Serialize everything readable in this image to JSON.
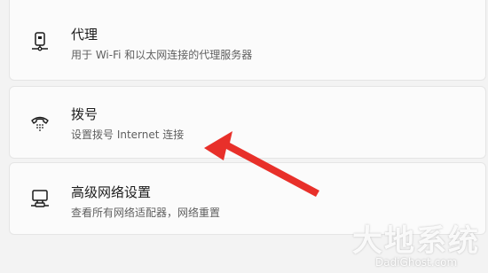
{
  "items": [
    {
      "title": "代理",
      "description": "用于 Wi-Fi 和以太网连接的代理服务器",
      "icon": "proxy-server-icon"
    },
    {
      "title": "拨号",
      "description": "设置拨号 Internet 连接",
      "icon": "dial-up-phone-icon"
    },
    {
      "title": "高级网络设置",
      "description": "查看所有网络适配器，网络重置",
      "icon": "network-pc-icon"
    }
  ],
  "watermark": {
    "logo_text": "大地系统",
    "url": "DadiGhost.com"
  },
  "colors": {
    "arrow": "#e8302a",
    "card": "#fbfbfb",
    "background": "#f3f3f3"
  }
}
